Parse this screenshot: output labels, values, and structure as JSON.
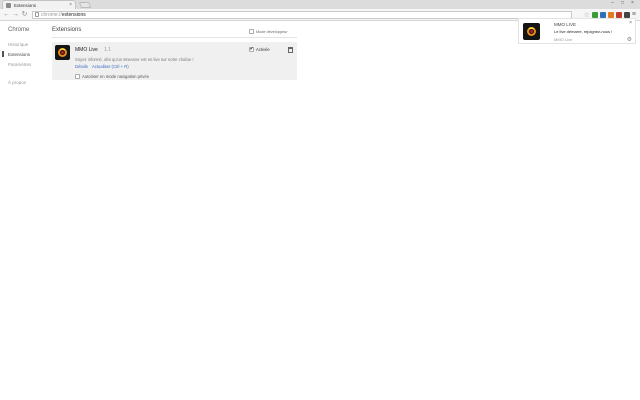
{
  "tab": {
    "title": "Extensions",
    "close_glyph": "×"
  },
  "window_controls": {
    "minimize": "–",
    "maximize": "□",
    "close": "×"
  },
  "toolbar": {
    "back_icon": "←",
    "forward_icon": "→",
    "reload_icon": "↻",
    "url_scheme": "chrome://",
    "url_path": "extensions",
    "star_icon": "☆",
    "menu_icon": "≡"
  },
  "sidebar": {
    "brand": "Chrome",
    "items": [
      {
        "label": "Historique"
      },
      {
        "label": "Extensions"
      },
      {
        "label": "Paramètres"
      },
      {
        "label": "À propos"
      }
    ]
  },
  "main": {
    "title": "Extensions",
    "developer_mode_label": "Mode développeur"
  },
  "extension": {
    "name": "MMO Live",
    "version": "1.1",
    "description": "Soyez informé, dès qu'un streamer est en live sur notre chaîne !",
    "details_link": "Détails",
    "shortcut_link": "Actualiser (Ctrl + R)",
    "enabled_label": "Activée",
    "enabled": true,
    "incognito_label": "Autoriser en mode navigation privée",
    "incognito": false
  },
  "notification": {
    "title": "MMO LIVE",
    "message": "Le live démarre, rejoignez-nous !",
    "source": "MMO Live",
    "close_glyph": "×",
    "settings_glyph": "⚙"
  },
  "colors": {
    "accent_link": "#3b6bbf",
    "icon_orange": "#e88a1a",
    "icon_red": "#c01a1a"
  }
}
